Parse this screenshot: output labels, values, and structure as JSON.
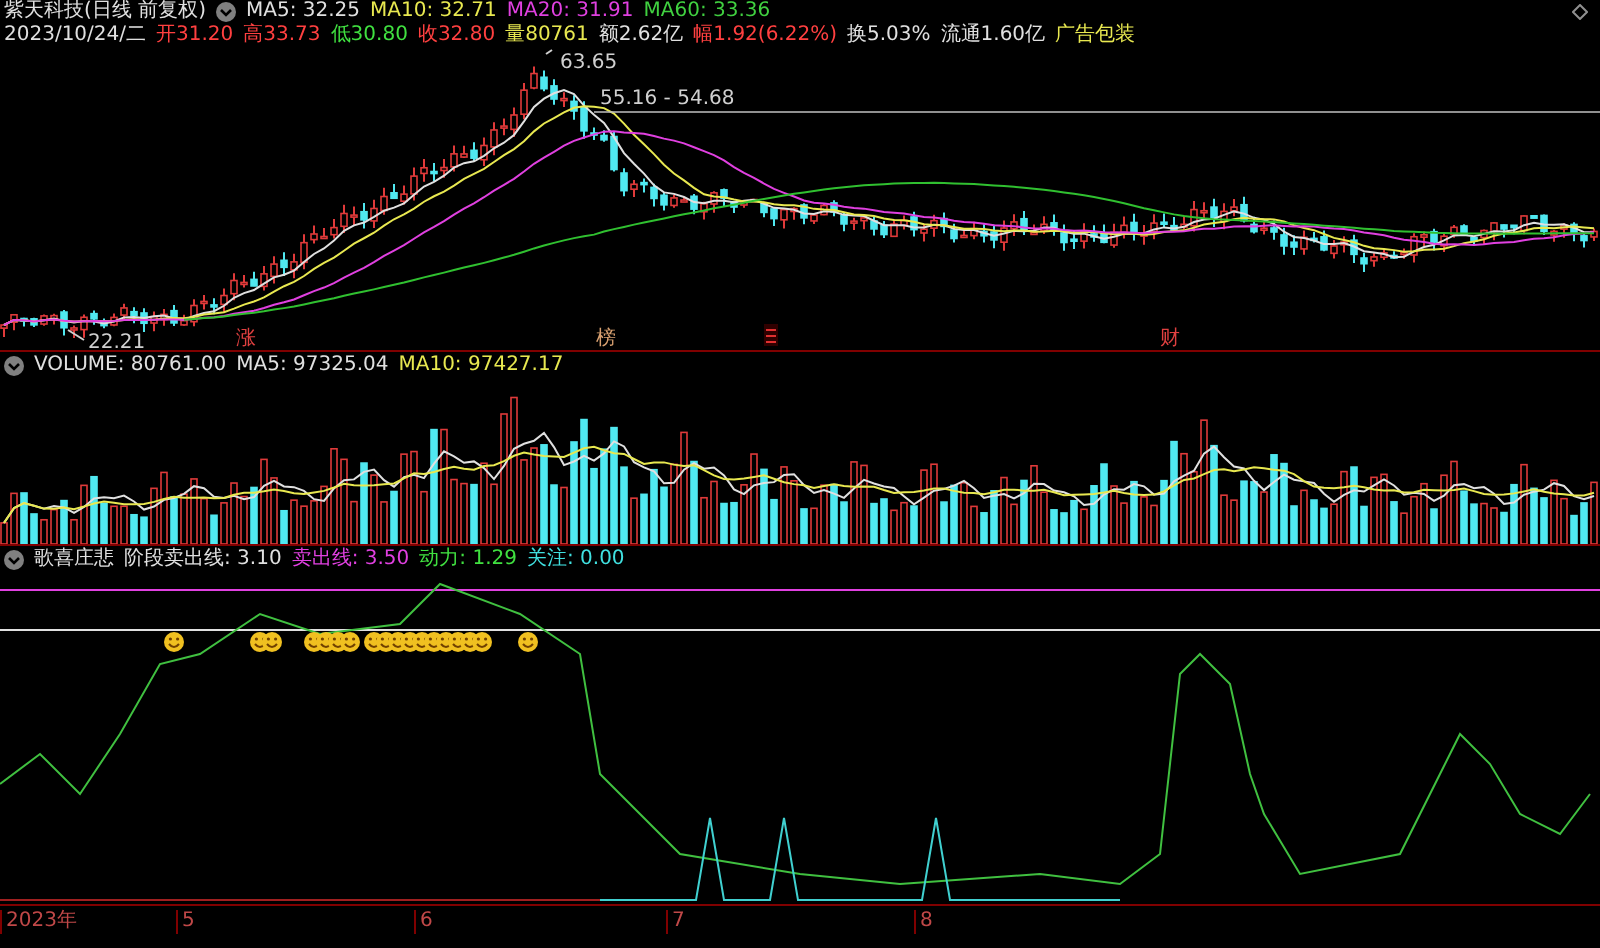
{
  "title_row": {
    "stock": "紫天科技(日线 前复权)",
    "averages": [
      {
        "text": "MA5: 32.25",
        "color": "#e0e0e0"
      },
      {
        "text": "MA10: 32.71",
        "color": "#e8e850"
      },
      {
        "text": "MA20: 31.91",
        "color": "#e040e0"
      },
      {
        "text": "MA60: 33.36",
        "color": "#40d040"
      }
    ]
  },
  "quote_row": {
    "date": "2023/10/24/二",
    "fields": [
      {
        "text": "开31.20",
        "color": "#ff4040"
      },
      {
        "text": "高33.73",
        "color": "#ff4040"
      },
      {
        "text": "低30.80",
        "color": "#40e040"
      },
      {
        "text": "收32.80",
        "color": "#ff4040"
      },
      {
        "text": "量80761",
        "color": "#e8e850"
      },
      {
        "text": "额2.62亿",
        "color": "#e0e0e0"
      },
      {
        "text": "幅1.92(6.22%)",
        "color": "#ff4040"
      },
      {
        "text": "换5.03%",
        "color": "#e0e0e0"
      },
      {
        "text": "流通1.60亿",
        "color": "#e0e0e0"
      },
      {
        "text": "广告包装",
        "color": "#e8e850"
      }
    ]
  },
  "price_chart": {
    "high_label": "63.65",
    "low_label": "22.21",
    "level_label": "55.16 - 54.68",
    "markers": [
      "涨",
      "榜",
      "财"
    ]
  },
  "volume_row": [
    {
      "text": "VOLUME: 80761.00",
      "color": "#e0e0e0"
    },
    {
      "text": "MA5: 97325.04",
      "color": "#e0e0e0"
    },
    {
      "text": "MA10: 97427.17",
      "color": "#e8e850"
    }
  ],
  "indicator_row": {
    "name": "歌喜庄悲",
    "values": [
      {
        "text": "阶段卖出线: 3.10",
        "color": "#e0e0e0"
      },
      {
        "text": "卖出线: 3.50",
        "color": "#e040e0"
      },
      {
        "text": "动力: 1.29",
        "color": "#40e040"
      },
      {
        "text": "关注: 0.00",
        "color": "#40e0e0"
      }
    ]
  },
  "time_axis": [
    "2023年",
    "5",
    "6",
    "7",
    "8"
  ]
}
